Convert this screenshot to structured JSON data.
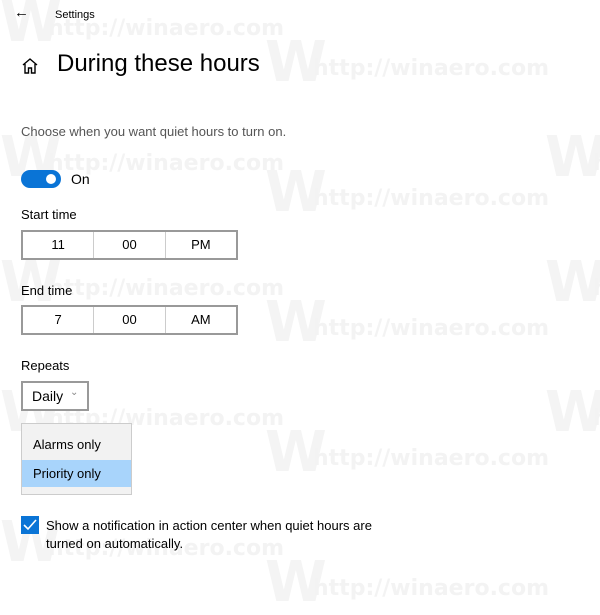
{
  "window": {
    "app_title": "Settings",
    "back_icon": "back-arrow-icon"
  },
  "header": {
    "home_icon": "home-icon",
    "title": "During these hours"
  },
  "main": {
    "description": "Choose when you want quiet hours to turn on.",
    "toggle": {
      "state": true,
      "label": "On"
    },
    "start_time": {
      "label": "Start time",
      "hour": "11",
      "minute": "00",
      "period": "PM"
    },
    "end_time": {
      "label": "End time",
      "hour": "7",
      "minute": "00",
      "period": "AM"
    },
    "repeats": {
      "label": "Repeats",
      "value": "Daily",
      "chevron_icon": "chevron-down-icon"
    },
    "dropdown": {
      "options": [
        {
          "label": "Alarms only",
          "selected": false
        },
        {
          "label": "Priority only",
          "selected": true
        }
      ]
    },
    "notification_checkbox": {
      "checked": true,
      "label": "Show a notification in action center when quiet hours are turned on automatically."
    }
  },
  "watermark": {
    "text": "http://winaero.com",
    "letter": "W"
  },
  "colors": {
    "accent": "#0a74d6",
    "selected_option": "#a8d4fb"
  }
}
